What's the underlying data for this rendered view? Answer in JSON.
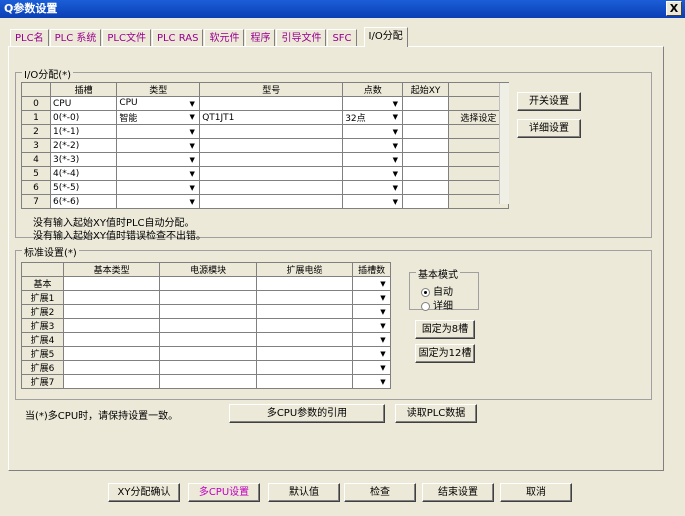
{
  "window": {
    "title": "Q参数设置",
    "close": "X"
  },
  "tabs": [
    "PLC名",
    "PLC 系统",
    "PLC文件",
    "PLC RAS",
    "软元件",
    "程序",
    "引导文件",
    "SFC",
    "I/O分配"
  ],
  "io": {
    "legend": "I/O分配(*)",
    "headers": [
      "插槽",
      "类型",
      "型号",
      "点数",
      "起始XY"
    ],
    "rows": [
      {
        "n": "0",
        "slot": "CPU",
        "type": "CPU",
        "model": "",
        "points": "",
        "start": ""
      },
      {
        "n": "1",
        "slot": "0(*-0)",
        "type": "智能",
        "model": "QT1JT1",
        "points": "32点",
        "start": "",
        "btn": "选择设定"
      },
      {
        "n": "2",
        "slot": "1(*-1)",
        "type": "",
        "model": "",
        "points": "",
        "start": ""
      },
      {
        "n": "3",
        "slot": "2(*-2)",
        "type": "",
        "model": "",
        "points": "",
        "start": ""
      },
      {
        "n": "4",
        "slot": "3(*-3)",
        "type": "",
        "model": "",
        "points": "",
        "start": ""
      },
      {
        "n": "5",
        "slot": "4(*-4)",
        "type": "",
        "model": "",
        "points": "",
        "start": ""
      },
      {
        "n": "6",
        "slot": "5(*-5)",
        "type": "",
        "model": "",
        "points": "",
        "start": ""
      },
      {
        "n": "7",
        "slot": "6(*-6)",
        "type": "",
        "model": "",
        "points": "",
        "start": ""
      }
    ],
    "switch_btn": "开关设置",
    "detail_btn": "详细设置",
    "note1": "没有输入起始XY值时PLC自动分配。",
    "note2": "没有输入起始XY值时错误检查不出错。"
  },
  "std": {
    "legend": "标准设置(*)",
    "headers": [
      "基本类型",
      "电源模块",
      "扩展电缆",
      "插槽数"
    ],
    "rows": [
      "基本",
      "扩展1",
      "扩展2",
      "扩展3",
      "扩展4",
      "扩展5",
      "扩展6",
      "扩展7"
    ]
  },
  "mode": {
    "legend": "基本模式",
    "auto": "自动",
    "detail": "详细",
    "fix8": "固定为8槽",
    "fix12": "固定为12槽"
  },
  "multi_note": "当(*)多CPU时，请保持设置一致。",
  "multi_btn": "多CPU参数的引用",
  "read_btn": "读取PLC数据",
  "bottom": [
    "XY分配确认",
    "多CPU设置",
    "默认值",
    "检查",
    "结束设置",
    "取消"
  ]
}
